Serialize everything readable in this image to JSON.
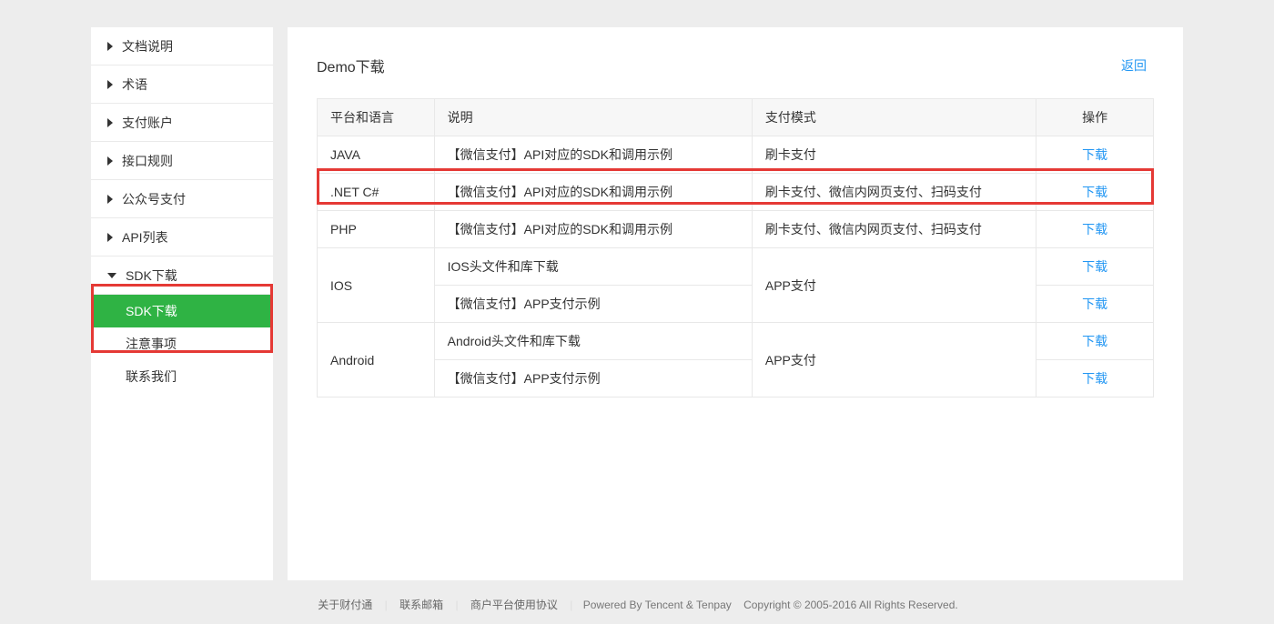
{
  "sidebar": {
    "items": [
      {
        "label": "文档说明",
        "arrow": "right"
      },
      {
        "label": "术语",
        "arrow": "right"
      },
      {
        "label": "支付账户",
        "arrow": "right"
      },
      {
        "label": "接口规则",
        "arrow": "right"
      },
      {
        "label": "公众号支付",
        "arrow": "right"
      },
      {
        "label": "API列表",
        "arrow": "right"
      },
      {
        "label": "SDK下载",
        "arrow": "down"
      }
    ],
    "subitems": [
      {
        "label": "SDK下载",
        "active": true
      },
      {
        "label": "注意事项",
        "active": false
      },
      {
        "label": "联系我们",
        "active": false
      }
    ]
  },
  "main": {
    "title": "Demo下载",
    "back": "返回",
    "table": {
      "headers": [
        "平台和语言",
        "说明",
        "支付模式",
        "操作"
      ],
      "download_label": "下载",
      "rows": [
        {
          "platform": "JAVA",
          "desc": "【微信支付】API对应的SDK和调用示例",
          "mode": "刷卡支付"
        },
        {
          "platform": ".NET C#",
          "desc": "【微信支付】API对应的SDK和调用示例",
          "mode": "刷卡支付、微信内网页支付、扫码支付"
        },
        {
          "platform": "PHP",
          "desc": "【微信支付】API对应的SDK和调用示例",
          "mode": "刷卡支付、微信内网页支付、扫码支付"
        }
      ],
      "group_ios": {
        "platform": "IOS",
        "mode": "APP支付",
        "descs": [
          "IOS头文件和库下载",
          "【微信支付】APP支付示例"
        ]
      },
      "group_android": {
        "platform": "Android",
        "mode": "APP支付",
        "descs": [
          "Android头文件和库下载",
          "【微信支付】APP支付示例"
        ]
      }
    }
  },
  "footer": {
    "about": "关于财付通",
    "contact": "联系邮箱",
    "agreement": "商户平台使用协议",
    "powered": "Powered By Tencent & Tenpay",
    "copyright": "Copyright © 2005-2016 All Rights Reserved."
  }
}
